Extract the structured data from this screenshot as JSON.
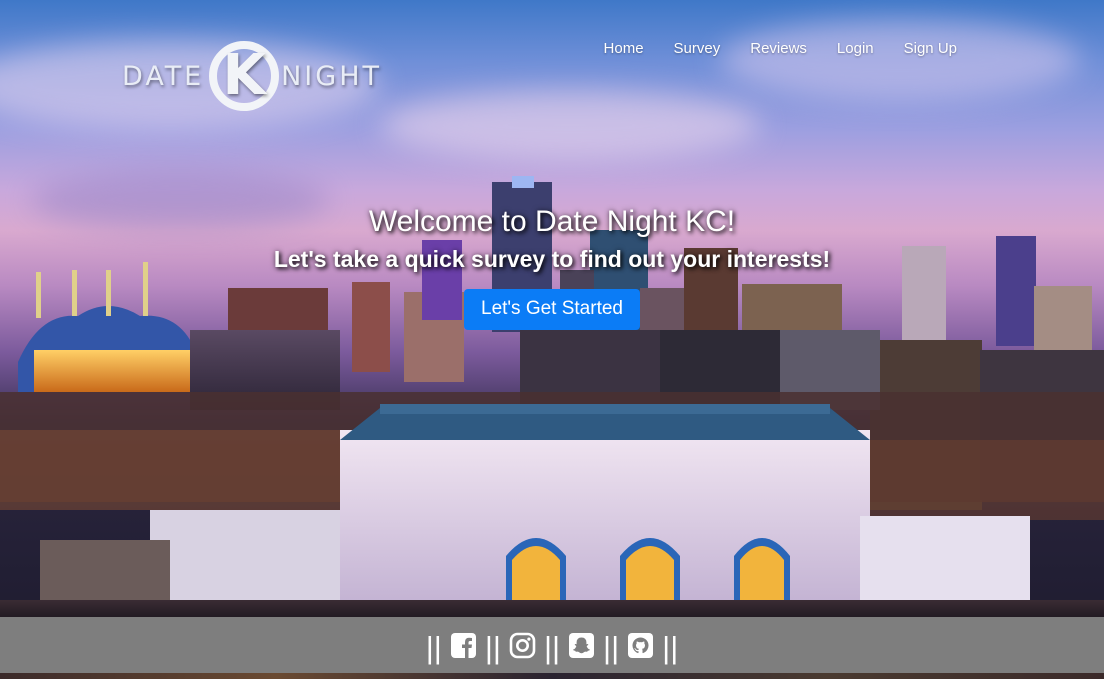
{
  "brand": {
    "word_left": "DATE",
    "mark_letter": "K",
    "word_right": "NIGHT"
  },
  "nav": {
    "items": [
      "Home",
      "Survey",
      "Reviews",
      "Login",
      "Sign Up"
    ]
  },
  "hero": {
    "title": "Welcome to Date Night KC!",
    "subtitle": "Let's take a quick survey to find out your interests!",
    "cta_label": "Let's Get Started"
  },
  "footer": {
    "separator": "||",
    "icons": [
      "facebook-icon",
      "instagram-icon",
      "snapchat-icon",
      "github-icon"
    ]
  },
  "colors": {
    "cta": "#0b7cf6",
    "footer_bg": "#7e7e7e",
    "text": "#ffffff"
  }
}
